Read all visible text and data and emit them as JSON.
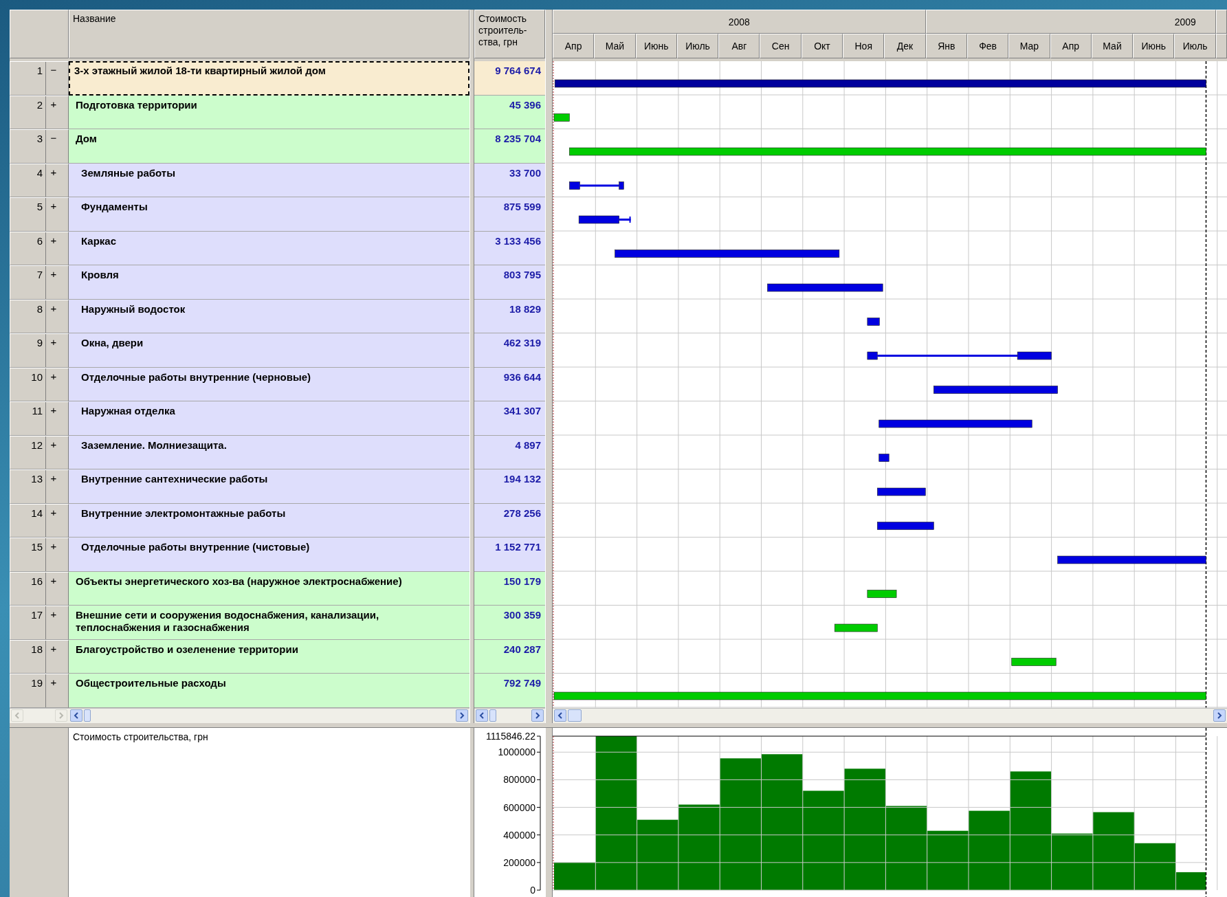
{
  "table": {
    "columns": [
      {
        "label": "Название"
      },
      {
        "label": "Стоимость строитель-ства, грн"
      }
    ],
    "rows": [
      {
        "number": "1",
        "toggle": "−",
        "name": "3-х этажный жилой 18-ти квартирный жилой дом",
        "cost": "9 764 674",
        "kind": "project",
        "selected": true,
        "children": [
          {
            "number": "2",
            "toggle": "+",
            "name": "Подготовка территории",
            "cost": "45 396",
            "kind": "group",
            "selected": false
          },
          {
            "number": "3",
            "toggle": "−",
            "name": "Дом",
            "cost": "8 235 704",
            "kind": "group",
            "selected": false,
            "children": [
              {
                "number": "4",
                "toggle": "+",
                "name": "Земляные работы",
                "cost": "33 700",
                "kind": "task",
                "selected": false
              },
              {
                "number": "5",
                "toggle": "+",
                "name": "Фундаменты",
                "cost": "875 599",
                "kind": "task",
                "selected": false
              },
              {
                "number": "6",
                "toggle": "+",
                "name": "Каркас",
                "cost": "3 133 456",
                "kind": "task",
                "selected": false
              },
              {
                "number": "7",
                "toggle": "+",
                "name": "Кровля",
                "cost": "803 795",
                "kind": "task",
                "selected": false
              },
              {
                "number": "8",
                "toggle": "+",
                "name": "Наружный водосток",
                "cost": "18 829",
                "kind": "task",
                "selected": false
              },
              {
                "number": "9",
                "toggle": "+",
                "name": "Окна, двери",
                "cost": "462 319",
                "kind": "task",
                "selected": false
              },
              {
                "number": "10",
                "toggle": "+",
                "name": "Отделочные работы внутренние (черновые)",
                "cost": "936 644",
                "kind": "task",
                "selected": false
              },
              {
                "number": "11",
                "toggle": "+",
                "name": "Наружная отделка",
                "cost": "341 307",
                "kind": "task",
                "selected": false
              },
              {
                "number": "12",
                "toggle": "+",
                "name": "Заземление. Молниезащита.",
                "cost": "4 897",
                "kind": "task",
                "selected": false
              },
              {
                "number": "13",
                "toggle": "+",
                "name": "Внутренние сантехнические работы",
                "cost": "194 132",
                "kind": "task",
                "selected": false
              },
              {
                "number": "14",
                "toggle": "+",
                "name": "Внутренние электромонтажные работы",
                "cost": "278 256",
                "kind": "task",
                "selected": false
              },
              {
                "number": "15",
                "toggle": "+",
                "name": "Отделочные работы внутренние (чистовые)",
                "cost": "1 152 771",
                "kind": "task",
                "selected": false
              }
            ]
          },
          {
            "number": "16",
            "toggle": "+",
            "name": "Объекты энергетического хоз-ва (наружное электроснабжение)",
            "cost": "150 179",
            "kind": "group",
            "selected": false
          },
          {
            "number": "17",
            "toggle": "+",
            "name": "Внешние сети и сооружения водоснабжения, канализации, теплоснабжения и газоснабжения",
            "cost": "300 359",
            "kind": "group",
            "selected": false
          },
          {
            "number": "18",
            "toggle": "+",
            "name": "Благоустройство и озеленение территории",
            "cost": "240 287",
            "kind": "group",
            "selected": false
          },
          {
            "number": "19",
            "toggle": "+",
            "name": "Общестроительные расходы",
            "cost": "792 749",
            "kind": "group",
            "selected": false
          }
        ]
      }
    ]
  },
  "gantt": {
    "years": [
      {
        "label": "2008",
        "months": [
          "Апр",
          "Май",
          "Июнь",
          "Июль",
          "Авг",
          "Сен",
          "Окт",
          "Ноя",
          "Дек"
        ]
      },
      {
        "label": "2009",
        "months": [
          "Янв",
          "Фев",
          "Мар",
          "Апр",
          "Май",
          "Июнь",
          "Июль"
        ]
      }
    ]
  },
  "cost_chart": {
    "chart_data": {
      "type": "bar",
      "grid": true,
      "series": [
        {
          "name": "Стоимость строительства, грн",
          "color": "#007a00",
          "values": [
            200000,
            1115846,
            510000,
            620000,
            955000,
            985000,
            720000,
            880000,
            610000,
            430000,
            575000,
            860000,
            410000,
            565000,
            340000,
            130000
          ]
        }
      ],
      "ylim": [
        0,
        1115846.22
      ],
      "yticks": [
        0,
        200000,
        400000,
        600000,
        800000,
        1000000,
        {
          "value": 1115846.22,
          "label": "1115846.22"
        }
      ]
    }
  }
}
